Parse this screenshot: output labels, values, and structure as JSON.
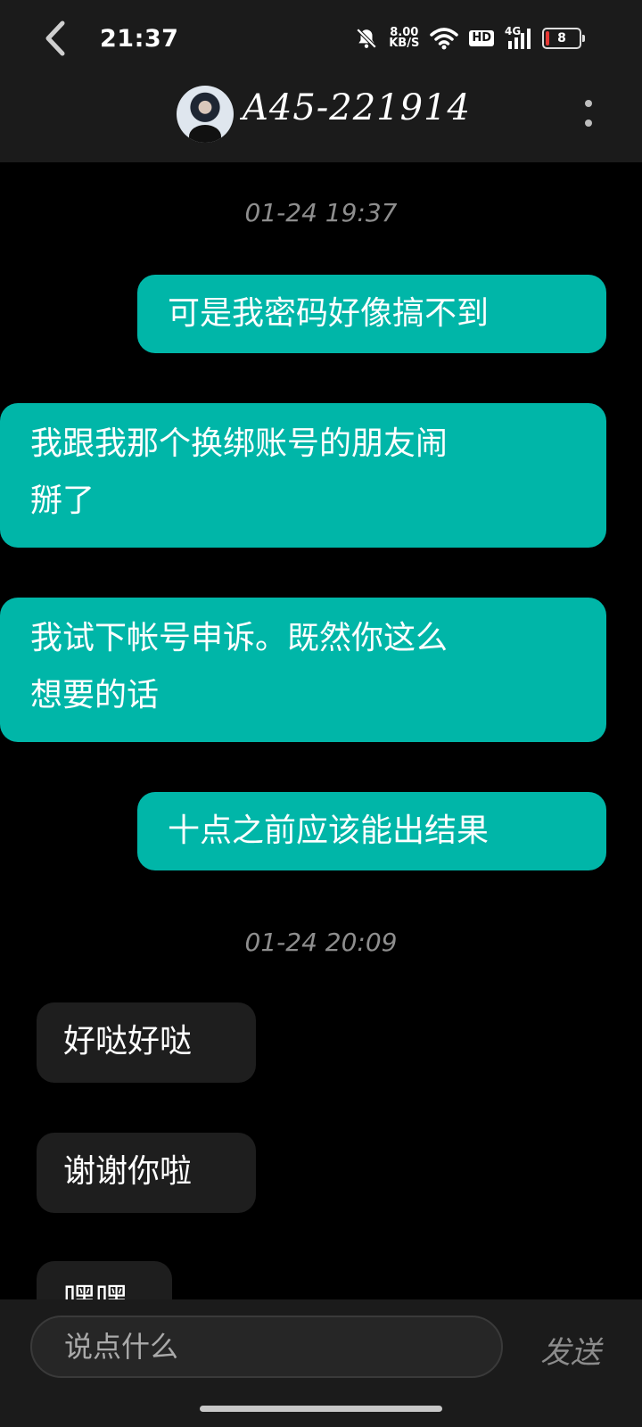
{
  "status_bar": {
    "time": "21:37",
    "net_speed_value": "8.00",
    "net_speed_unit": "KB/S",
    "hd_label": "HD",
    "signal_label": "4G",
    "battery_level": "8",
    "icons": [
      "mute-bell-icon",
      "wifi-icon",
      "signal-icon",
      "battery-icon"
    ]
  },
  "header": {
    "contact_name": "A45-221914",
    "icons": [
      "back-arrow-icon",
      "avatar",
      "more-vertical-icon"
    ]
  },
  "messages": {
    "ts1": "01-24 19:37",
    "m1": "可是我密码好像搞不到",
    "m2a": "我跟我那个换绑账号的朋友闹",
    "m2b": "掰了",
    "m3a": "我试下帐号申诉。既然你这么",
    "m3b": "想要的话",
    "m4": "十点之前应该能出结果",
    "ts2": "01-24 20:09",
    "m5": "好哒好哒",
    "m6": "谢谢你啦",
    "m7": "嘿嘿"
  },
  "input": {
    "placeholder": "说点什么",
    "send_label": "发送"
  },
  "colors": {
    "outgoing_bubble": "#00b6a8",
    "incoming_bubble": "#1e1e1e",
    "bar_background": "#1b1b1b"
  }
}
